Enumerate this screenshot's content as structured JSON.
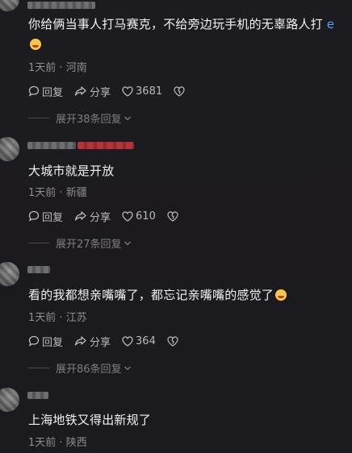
{
  "comments": [
    {
      "text": "你给俩当事人打马赛克，不给旁边玩手机的无辜路人打",
      "text_line2": "",
      "time": "1天前",
      "location": "河南",
      "reply_label": "回复",
      "share_label": "分享",
      "likes": "3681",
      "expand_label": "展开38条回复"
    },
    {
      "text": "大城市就是开放",
      "time": "1天前",
      "location": "新疆",
      "reply_label": "回复",
      "share_label": "分享",
      "likes": "610",
      "expand_label": "展开27条回复"
    },
    {
      "text": "看的我都想亲嘴嘴了，都忘记亲嘴嘴的感觉了",
      "time": "1天前",
      "location": "江苏",
      "reply_label": "回复",
      "share_label": "分享",
      "likes": "364",
      "expand_label": "展开86条回复"
    },
    {
      "text": "上海地铁又得出新规了",
      "time": "1天前",
      "location": "陕西"
    }
  ],
  "separator": " · ",
  "colors": {
    "background": "#1c1b1f",
    "text": "#f2f2f2",
    "meta": "#8d8d94",
    "action": "#b9b9c0"
  }
}
